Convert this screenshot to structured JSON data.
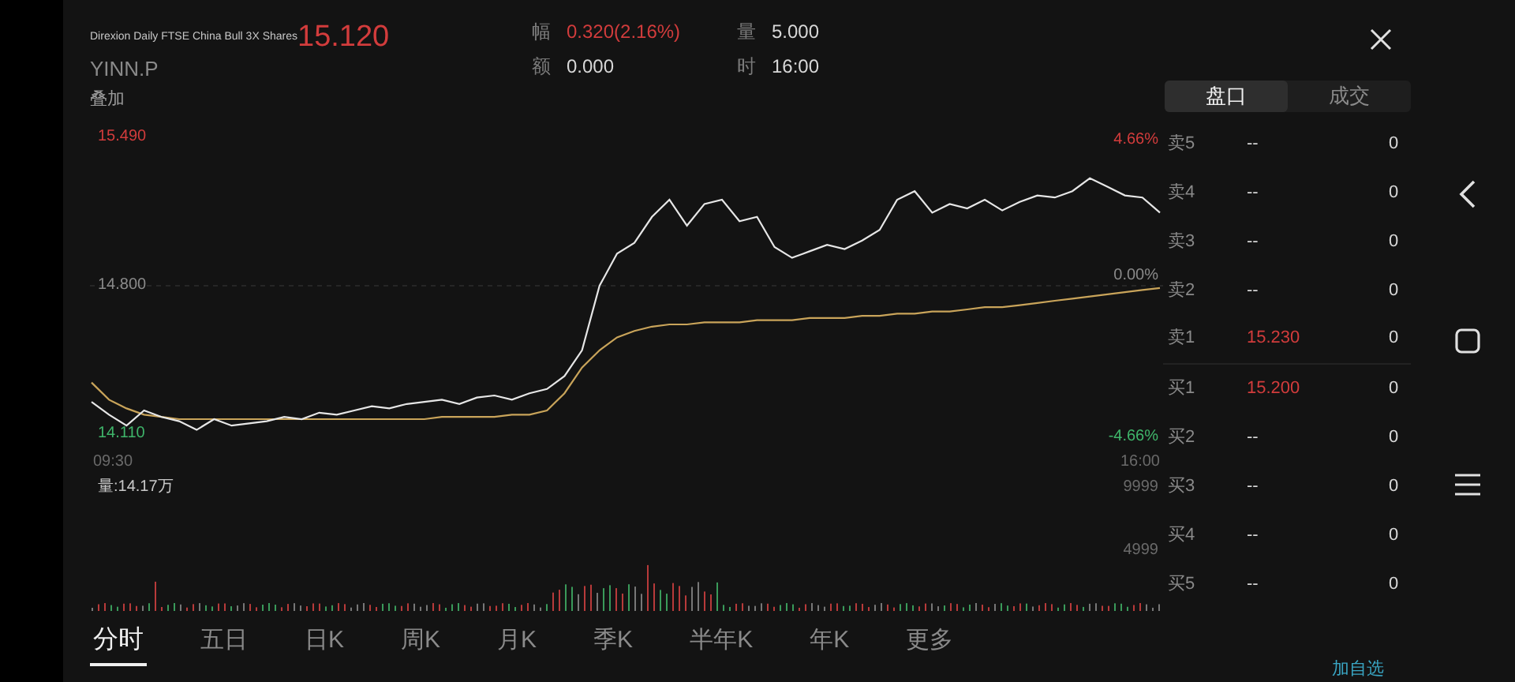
{
  "header": {
    "name": "Direxion Daily FTSE China Bull 3X Shares",
    "price": "15.120",
    "ticker": "YINN.P",
    "overlay": "叠加",
    "stats": [
      {
        "label": "幅",
        "value": "0.320(2.16%)",
        "color": "#d23c3c"
      },
      {
        "label": "量",
        "value": "5.000",
        "color": "#d8d8d8"
      },
      {
        "label": "额",
        "value": "0.000",
        "color": "#d8d8d8"
      },
      {
        "label": "时",
        "value": "16:00",
        "color": "#d8d8d8"
      }
    ]
  },
  "price_chart": {
    "chart_data": {
      "type": "line",
      "ylim": [
        14.11,
        15.49
      ],
      "yticks": [
        {
          "value": 15.49,
          "label": "15.490"
        },
        {
          "value": 14.8,
          "label": "14.800"
        },
        {
          "value": 14.11,
          "label": "14.110"
        }
      ],
      "series": [
        {
          "color": "#e6e6e6",
          "values": [
            14.26,
            14.2,
            14.15,
            14.22,
            14.19,
            14.17,
            14.13,
            14.18,
            14.15,
            14.16,
            14.17,
            14.19,
            14.18,
            14.21,
            14.2,
            14.22,
            14.24,
            14.23,
            14.25,
            14.26,
            14.27,
            14.25,
            14.28,
            14.29,
            14.27,
            14.3,
            14.32,
            14.38,
            14.5,
            14.8,
            14.95,
            15.0,
            15.12,
            15.2,
            15.08,
            15.18,
            15.2,
            15.1,
            15.12,
            14.98,
            14.93,
            14.96,
            14.99,
            14.97,
            15.01,
            15.06,
            15.2,
            15.24,
            15.14,
            15.18,
            15.16,
            15.2,
            15.15,
            15.19,
            15.22,
            15.21,
            15.24,
            15.3,
            15.26,
            15.22,
            15.21,
            15.14
          ]
        },
        {
          "color": "#c9a45a",
          "values": [
            14.35,
            14.27,
            14.23,
            14.2,
            14.19,
            14.18,
            14.18,
            14.18,
            14.18,
            14.18,
            14.18,
            14.18,
            14.18,
            14.18,
            14.18,
            14.18,
            14.18,
            14.18,
            14.18,
            14.18,
            14.19,
            14.19,
            14.19,
            14.19,
            14.2,
            14.2,
            14.22,
            14.3,
            14.42,
            14.5,
            14.56,
            14.59,
            14.61,
            14.62,
            14.62,
            14.63,
            14.63,
            14.63,
            14.64,
            14.64,
            14.64,
            14.65,
            14.65,
            14.65,
            14.66,
            14.66,
            14.67,
            14.67,
            14.68,
            14.68,
            14.69,
            14.7,
            14.7,
            14.71,
            14.72,
            14.73,
            14.74,
            14.75,
            14.76,
            14.77,
            14.78,
            14.79
          ]
        }
      ]
    }
  },
  "time_axis": {
    "start": "09:30",
    "end": "16:00"
  },
  "pct_axis": {
    "high": "4.66%",
    "mid": "0.00%",
    "low": "-4.66%"
  },
  "volume": {
    "label": "量:14.17万",
    "max": "9999",
    "mid": "4999"
  },
  "book_tabs": [
    {
      "label": "盘口",
      "selected": true
    },
    {
      "label": "成交",
      "selected": false
    }
  ],
  "order_book": [
    {
      "label": "卖5",
      "price": "--",
      "qty": "0",
      "color": "#d8d8d8"
    },
    {
      "label": "卖4",
      "price": "--",
      "qty": "0",
      "color": "#d8d8d8"
    },
    {
      "label": "卖3",
      "price": "--",
      "qty": "0",
      "color": "#d8d8d8"
    },
    {
      "label": "卖2",
      "price": "--",
      "qty": "0",
      "color": "#d8d8d8"
    },
    {
      "label": "卖1",
      "price": "15.230",
      "qty": "0",
      "color": "#d23c3c"
    },
    {
      "label": "买1",
      "price": "15.200",
      "qty": "0",
      "color": "#d23c3c"
    },
    {
      "label": "买2",
      "price": "--",
      "qty": "0",
      "color": "#d8d8d8"
    },
    {
      "label": "买3",
      "price": "--",
      "qty": "0",
      "color": "#d8d8d8"
    },
    {
      "label": "买4",
      "price": "--",
      "qty": "0",
      "color": "#d8d8d8"
    },
    {
      "label": "买5",
      "price": "--",
      "qty": "0",
      "color": "#d8d8d8"
    }
  ],
  "period_tabs": [
    {
      "label": "分时",
      "selected": true
    },
    {
      "label": "五日",
      "selected": false
    },
    {
      "label": "日K",
      "selected": false
    },
    {
      "label": "周K",
      "selected": false
    },
    {
      "label": "月K",
      "selected": false
    },
    {
      "label": "季K",
      "selected": false
    },
    {
      "label": "半年K",
      "selected": false
    },
    {
      "label": "年K",
      "selected": false
    },
    {
      "label": "更多",
      "selected": false
    }
  ],
  "add_watchlist": "加自选"
}
